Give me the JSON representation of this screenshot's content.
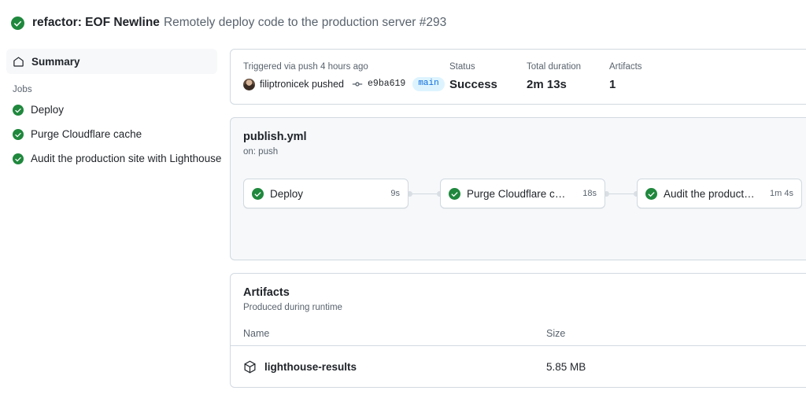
{
  "header": {
    "status_icon": "check-circle-icon",
    "commit_message": "refactor: EOF Newline",
    "workflow_title": "Remotely deploy code to the production server #293"
  },
  "sidebar": {
    "summary": {
      "icon": "home-icon",
      "label": "Summary"
    },
    "jobs_heading": "Jobs",
    "jobs": [
      {
        "icon": "check-circle-icon",
        "label": "Deploy"
      },
      {
        "icon": "check-circle-icon",
        "label": "Purge Cloudflare cache"
      },
      {
        "icon": "check-circle-icon",
        "label": "Audit the production site with Lighthouse"
      }
    ]
  },
  "meta": {
    "trigger_label": "Triggered via push 4 hours ago",
    "actor": "filiptronicek pushed",
    "commit_icon": "commit-icon",
    "commit_sha": "e9ba619",
    "branch": "main",
    "status_label": "Status",
    "status_value": "Success",
    "duration_label": "Total duration",
    "duration_value": "2m 13s",
    "artifacts_label": "Artifacts",
    "artifacts_value": "1"
  },
  "graph": {
    "title": "publish.yml",
    "subtitle": "on: push",
    "nodes": [
      {
        "icon": "check-circle-icon",
        "label": "Deploy",
        "duration": "9s"
      },
      {
        "icon": "check-circle-icon",
        "label": "Purge Cloudflare cache",
        "duration": "18s"
      },
      {
        "icon": "check-circle-icon",
        "label": "Audit the production site ...",
        "duration": "1m 4s"
      }
    ]
  },
  "artifacts": {
    "title": "Artifacts",
    "subtitle": "Produced during runtime",
    "columns": {
      "name": "Name",
      "size": "Size"
    },
    "rows": [
      {
        "icon": "package-icon",
        "name": "lighthouse-results",
        "size": "5.85 MB"
      }
    ]
  },
  "colors": {
    "success_green": "#1f883d",
    "border": "#d1d9e0",
    "muted_text": "#59636e",
    "canvas_subtle": "#f6f8fa",
    "accent_blue": "#0969da",
    "badge_bg": "#ddf4ff"
  }
}
